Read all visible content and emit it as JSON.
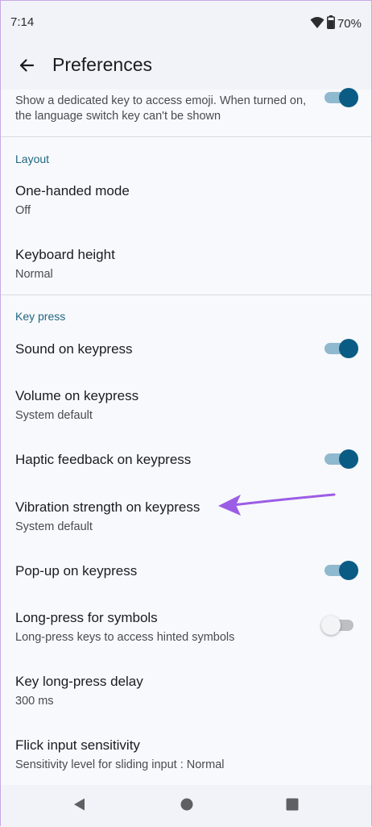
{
  "status": {
    "time": "7:14",
    "battery": "70%",
    "battery_level": 0.7
  },
  "appbar": {
    "title": "Preferences"
  },
  "emoji_item": {
    "subtitle": "Show a dedicated key to access emoji. When turned on, the language switch key can't be shown",
    "toggle_on": true
  },
  "sections": {
    "layout": {
      "header": "Layout",
      "one_handed": {
        "title": "One-handed mode",
        "subtitle": "Off"
      },
      "keyboard_height": {
        "title": "Keyboard height",
        "subtitle": "Normal"
      }
    },
    "key_press": {
      "header": "Key press",
      "sound": {
        "title": "Sound on keypress",
        "toggle_on": true
      },
      "volume": {
        "title": "Volume on keypress",
        "subtitle": "System default"
      },
      "haptic": {
        "title": "Haptic feedback on keypress",
        "toggle_on": true
      },
      "vibration": {
        "title": "Vibration strength on keypress",
        "subtitle": "System default"
      },
      "popup": {
        "title": "Pop-up on keypress",
        "toggle_on": true
      },
      "long_press_symbols": {
        "title": "Long-press for symbols",
        "subtitle": "Long-press keys to access hinted symbols",
        "toggle_on": false
      },
      "long_press_delay": {
        "title": "Key long-press delay",
        "subtitle": "300 ms"
      },
      "flick": {
        "title": "Flick input sensitivity",
        "subtitle": "Sensitivity level for sliding input : Normal"
      }
    }
  },
  "colors": {
    "accent": "#0b5c84",
    "section_header": "#1f6680",
    "annotation_arrow": "#9b5de5"
  },
  "icons": {
    "back": "arrow-back-icon",
    "wifi": "wifi-icon",
    "battery": "battery-icon",
    "nav_back": "triangle-back-icon",
    "nav_home": "circle-home-icon",
    "nav_recents": "square-recents-icon"
  }
}
